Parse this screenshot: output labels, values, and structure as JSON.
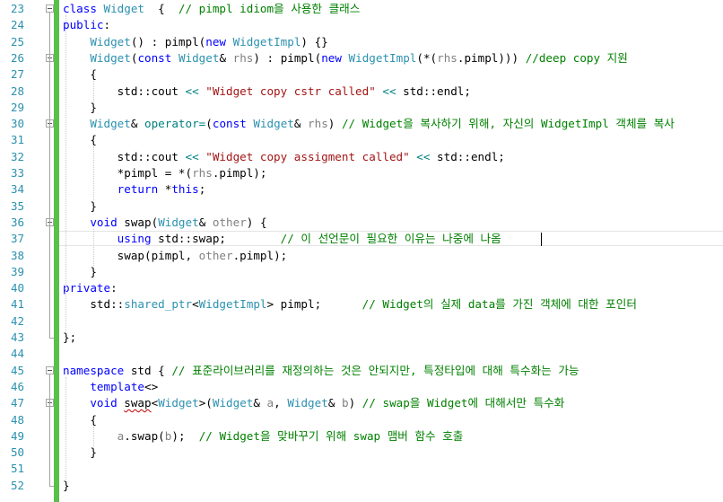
{
  "editor": {
    "lines": [
      {
        "n": "23",
        "parts": [
          [
            "kw",
            "class "
          ],
          [
            "ty",
            "Widget"
          ],
          [
            "",
            "  {  "
          ],
          [
            "cm",
            "// pimpl idiom을 사용한 클래스"
          ]
        ]
      },
      {
        "n": "24",
        "parts": [
          [
            "kw",
            "public"
          ],
          [
            "",
            ":"
          ]
        ]
      },
      {
        "n": "25",
        "parts": [
          [
            "",
            "    "
          ],
          [
            "ty",
            "Widget"
          ],
          [
            "",
            "() : pimpl("
          ],
          [
            "kw",
            "new "
          ],
          [
            "ty",
            "WidgetImpl"
          ],
          [
            "",
            ") {}"
          ]
        ]
      },
      {
        "n": "26",
        "parts": [
          [
            "",
            "    "
          ],
          [
            "ty",
            "Widget"
          ],
          [
            "",
            "("
          ],
          [
            "kw",
            "const "
          ],
          [
            "ty",
            "Widget"
          ],
          [
            "",
            "& "
          ],
          [
            "pm",
            "rhs"
          ],
          [
            "",
            ") : pimpl("
          ],
          [
            "kw",
            "new "
          ],
          [
            "ty",
            "WidgetImpl"
          ],
          [
            "",
            "(*("
          ],
          [
            "pm",
            "rhs"
          ],
          [
            "",
            ".pimpl))) "
          ],
          [
            "cm",
            "//deep copy 지원"
          ]
        ]
      },
      {
        "n": "27",
        "parts": [
          [
            "",
            "    {"
          ]
        ]
      },
      {
        "n": "28",
        "parts": [
          [
            "",
            "        std::cout "
          ],
          [
            "op",
            "<<"
          ],
          [
            "st",
            " \"Widget copy cstr called\""
          ],
          [
            "op",
            " <<"
          ],
          [
            "",
            " std::endl;"
          ]
        ]
      },
      {
        "n": "29",
        "parts": [
          [
            "",
            "    }"
          ]
        ]
      },
      {
        "n": "30",
        "parts": [
          [
            "",
            "    "
          ],
          [
            "ty",
            "Widget"
          ],
          [
            "",
            "& "
          ],
          [
            "op",
            "operator="
          ],
          [
            "",
            "("
          ],
          [
            "kw",
            "const "
          ],
          [
            "ty",
            "Widget"
          ],
          [
            "",
            "& "
          ],
          [
            "pm",
            "rhs"
          ],
          [
            "",
            ") "
          ],
          [
            "cm",
            "// Widget을 복사하기 위해, 자신의 WidgetImpl 객체를 복사"
          ]
        ]
      },
      {
        "n": "31",
        "parts": [
          [
            "",
            "    {"
          ]
        ]
      },
      {
        "n": "32",
        "parts": [
          [
            "",
            "        std::cout "
          ],
          [
            "op",
            "<<"
          ],
          [
            "st",
            " \"Widget copy assigment called\""
          ],
          [
            "op",
            " <<"
          ],
          [
            "",
            " std::endl;"
          ]
        ]
      },
      {
        "n": "33",
        "parts": [
          [
            "",
            "        *pimpl = *("
          ],
          [
            "pm",
            "rhs"
          ],
          [
            "",
            ".pimpl);"
          ]
        ]
      },
      {
        "n": "34",
        "parts": [
          [
            "",
            "        "
          ],
          [
            "kw",
            "return "
          ],
          [
            "",
            "*"
          ],
          [
            "kw",
            "this"
          ],
          [
            "",
            ";"
          ]
        ]
      },
      {
        "n": "35",
        "parts": [
          [
            "",
            "    }"
          ]
        ]
      },
      {
        "n": "36",
        "parts": [
          [
            "",
            "    "
          ],
          [
            "kw",
            "void "
          ],
          [
            "",
            "swap("
          ],
          [
            "ty",
            "Widget"
          ],
          [
            "",
            "& "
          ],
          [
            "pm",
            "other"
          ],
          [
            "",
            ") {"
          ]
        ]
      },
      {
        "n": "37",
        "parts": [
          [
            "",
            "        "
          ],
          [
            "kw",
            "using "
          ],
          [
            "",
            "std::swap;        "
          ],
          [
            "cm",
            "// 이 선언문이 필요한 이유는 나중에 나옴"
          ]
        ]
      },
      {
        "n": "38",
        "parts": [
          [
            "",
            "        swap(pimpl, "
          ],
          [
            "pm",
            "other"
          ],
          [
            "",
            ".pimpl);"
          ]
        ]
      },
      {
        "n": "39",
        "parts": [
          [
            "",
            "    }"
          ]
        ]
      },
      {
        "n": "40",
        "parts": [
          [
            "kw",
            "private"
          ],
          [
            "",
            ":"
          ]
        ]
      },
      {
        "n": "41",
        "parts": [
          [
            "",
            "    std::"
          ],
          [
            "ty",
            "shared_ptr"
          ],
          [
            "",
            "<"
          ],
          [
            "ty",
            "WidgetImpl"
          ],
          [
            "",
            "> pimpl;      "
          ],
          [
            "cm",
            "// Widget의 실제 data를 가진 객체에 대한 포인터"
          ]
        ]
      },
      {
        "n": "42",
        "parts": [
          [
            "",
            ""
          ]
        ]
      },
      {
        "n": "43",
        "parts": [
          [
            "",
            "};"
          ]
        ]
      },
      {
        "n": "44",
        "parts": [
          [
            "",
            ""
          ]
        ]
      },
      {
        "n": "45",
        "parts": [
          [
            "kw",
            "namespace "
          ],
          [
            "",
            "std { "
          ],
          [
            "cm",
            "// 표준라이브러리를 재정의하는 것은 안되지만, 특정타입에 대해 특수화는 가능"
          ]
        ]
      },
      {
        "n": "46",
        "parts": [
          [
            "",
            "    "
          ],
          [
            "kw",
            "template"
          ],
          [
            "",
            "<>"
          ]
        ]
      },
      {
        "n": "47",
        "parts": [
          [
            "",
            "    "
          ],
          [
            "kw",
            "void "
          ],
          [
            "squig",
            "swap"
          ],
          [
            "",
            "<"
          ],
          [
            "ty",
            "Widget"
          ],
          [
            "",
            ">("
          ],
          [
            "ty",
            "Widget"
          ],
          [
            "",
            "& "
          ],
          [
            "pm",
            "a"
          ],
          [
            "",
            ", "
          ],
          [
            "ty",
            "Widget"
          ],
          [
            "",
            "& "
          ],
          [
            "pm",
            "b"
          ],
          [
            "",
            ") "
          ],
          [
            "cm",
            "// swap을 Widget에 대해서만 특수화"
          ]
        ]
      },
      {
        "n": "48",
        "parts": [
          [
            "",
            "    {"
          ]
        ]
      },
      {
        "n": "49",
        "parts": [
          [
            "",
            "        "
          ],
          [
            "pm",
            "a"
          ],
          [
            "",
            ".swap("
          ],
          [
            "pm",
            "b"
          ],
          [
            "",
            ");  "
          ],
          [
            "cm",
            "// Widget을 맞바꾸기 위해 swap 맴버 함수 호출"
          ]
        ]
      },
      {
        "n": "50",
        "parts": [
          [
            "",
            "    }"
          ]
        ]
      },
      {
        "n": "51",
        "parts": [
          [
            "",
            ""
          ]
        ]
      },
      {
        "n": "52",
        "parts": [
          [
            "",
            "}"
          ]
        ]
      }
    ]
  },
  "colors": {
    "keyword": "#0000ff",
    "type": "#2b91af",
    "string": "#a31515",
    "comment": "#008000",
    "param": "#808080",
    "operator": "#008080",
    "change_bar": "#57c14a",
    "line_number": "#2b91af"
  }
}
